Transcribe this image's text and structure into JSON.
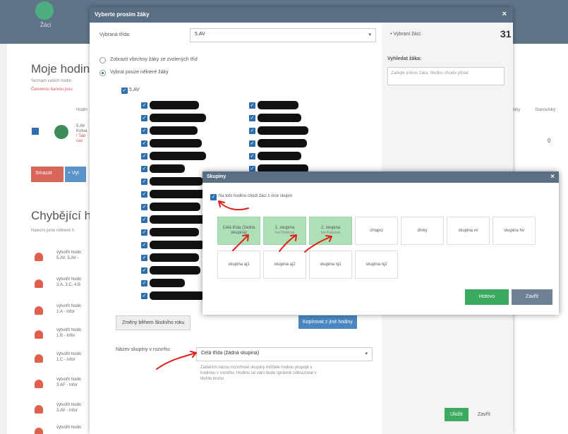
{
  "background": {
    "nav_label": "Žáci",
    "title1": "Moje hodiny",
    "small1": "Seznam vašich hodin",
    "small2": "Červenou barvou jsou",
    "col1": "Hodin",
    "col2": "Úlohy",
    "col3": "Stanovisky",
    "row_text": [
      "5.AV",
      "Kotva",
      "! Tab",
      "cas"
    ],
    "row_num": "0",
    "btn_red": "Smazat",
    "btn_blue": "+ Vyt",
    "title2": "Chybějící ho",
    "small3": "Nalezni jsme některé h",
    "list": [
      {
        "l1": "vytvořit hodin",
        "l2": "5.AV, 5.AV -"
      },
      {
        "l1": "vytvořit hodin",
        "l2": "3.A, 3.C, 4.B"
      },
      {
        "l1": "vytvořit hodin",
        "l2": "1.A - Infor"
      },
      {
        "l1": "vytvořit hodin",
        "l2": "1.B - Infor"
      },
      {
        "l1": "vytvořit hodin",
        "l2": "1.C - Infor"
      },
      {
        "l1": "vytvořit hodin",
        "l2": "3.AF - Infor"
      },
      {
        "l1": "vytvořit hodin",
        "l2": "3.AV - Infor"
      },
      {
        "l1": "vytvořit hodin",
        "l2": ""
      }
    ]
  },
  "dialog": {
    "title": "Vyberte prosím žáky",
    "class_label": "Vybraná třída:",
    "class_value": "5.AV",
    "radio_all": "Zobrazit všechny žáky ze zvolených tříd",
    "radio_some": "Vybrat pouze některé žáky",
    "class_checkbox": "5.AV",
    "btn_changes": "Změny během školního roku",
    "btn_copy": "Kopírovat z jiné hodiny",
    "group_label": "Název skupiny v rozvrhu:",
    "group_value": "Celá třída (žádná skupina)",
    "hint": [
      "Zadáním názvu rozvrhové skupiny můžete hodinu propojit s",
      "hodinou v rozvrhu. Hodinu se vám bude správně zobrazovat v",
      "těchto kruhu"
    ],
    "btn_ok": "Uložit",
    "btn_close": "Zavřít",
    "sidebar": {
      "selected_label": "• Vybraní žáci:",
      "selected_count": "31",
      "search_label": "Vyhledat žáka:",
      "search_placeholder": "Zadejte jméno žáka, hledno chcete přidat"
    }
  },
  "skupiny": {
    "title": "Skupiny",
    "checkbox_label": "Na tuto hodinu chodí žáci z více skupin",
    "groups_row1": [
      {
        "name": "Celá třída (žádná skupina)",
        "sub": "",
        "selected": true
      },
      {
        "name": "1. skupina",
        "sub": "Ins Fichtová",
        "selected": true
      },
      {
        "name": "2. skupina",
        "sub": "Ins Fuksová",
        "selected": true
      },
      {
        "name": "chlapci",
        "sub": "",
        "selected": false
      },
      {
        "name": "dívky",
        "sub": "",
        "selected": false
      },
      {
        "name": "skupina vv",
        "sub": "",
        "selected": false
      },
      {
        "name": "skupina hv",
        "sub": "",
        "selected": false
      }
    ],
    "groups_row2": [
      {
        "name": "skupina aj1",
        "sub": "",
        "selected": false
      },
      {
        "name": "skupina aj2",
        "sub": "",
        "selected": false
      },
      {
        "name": "skupina nj1",
        "sub": "",
        "selected": false
      },
      {
        "name": "skupina nj2",
        "sub": "",
        "selected": false
      }
    ],
    "btn_done": "Hotovo",
    "btn_close": "Zavřít"
  },
  "colors": {
    "header": "#5a6f84",
    "accent_blue": "#2f6fb0",
    "selected_group": "#aee0b8",
    "green_button": "#3cab5f",
    "annotation_red": "#e0201a"
  }
}
